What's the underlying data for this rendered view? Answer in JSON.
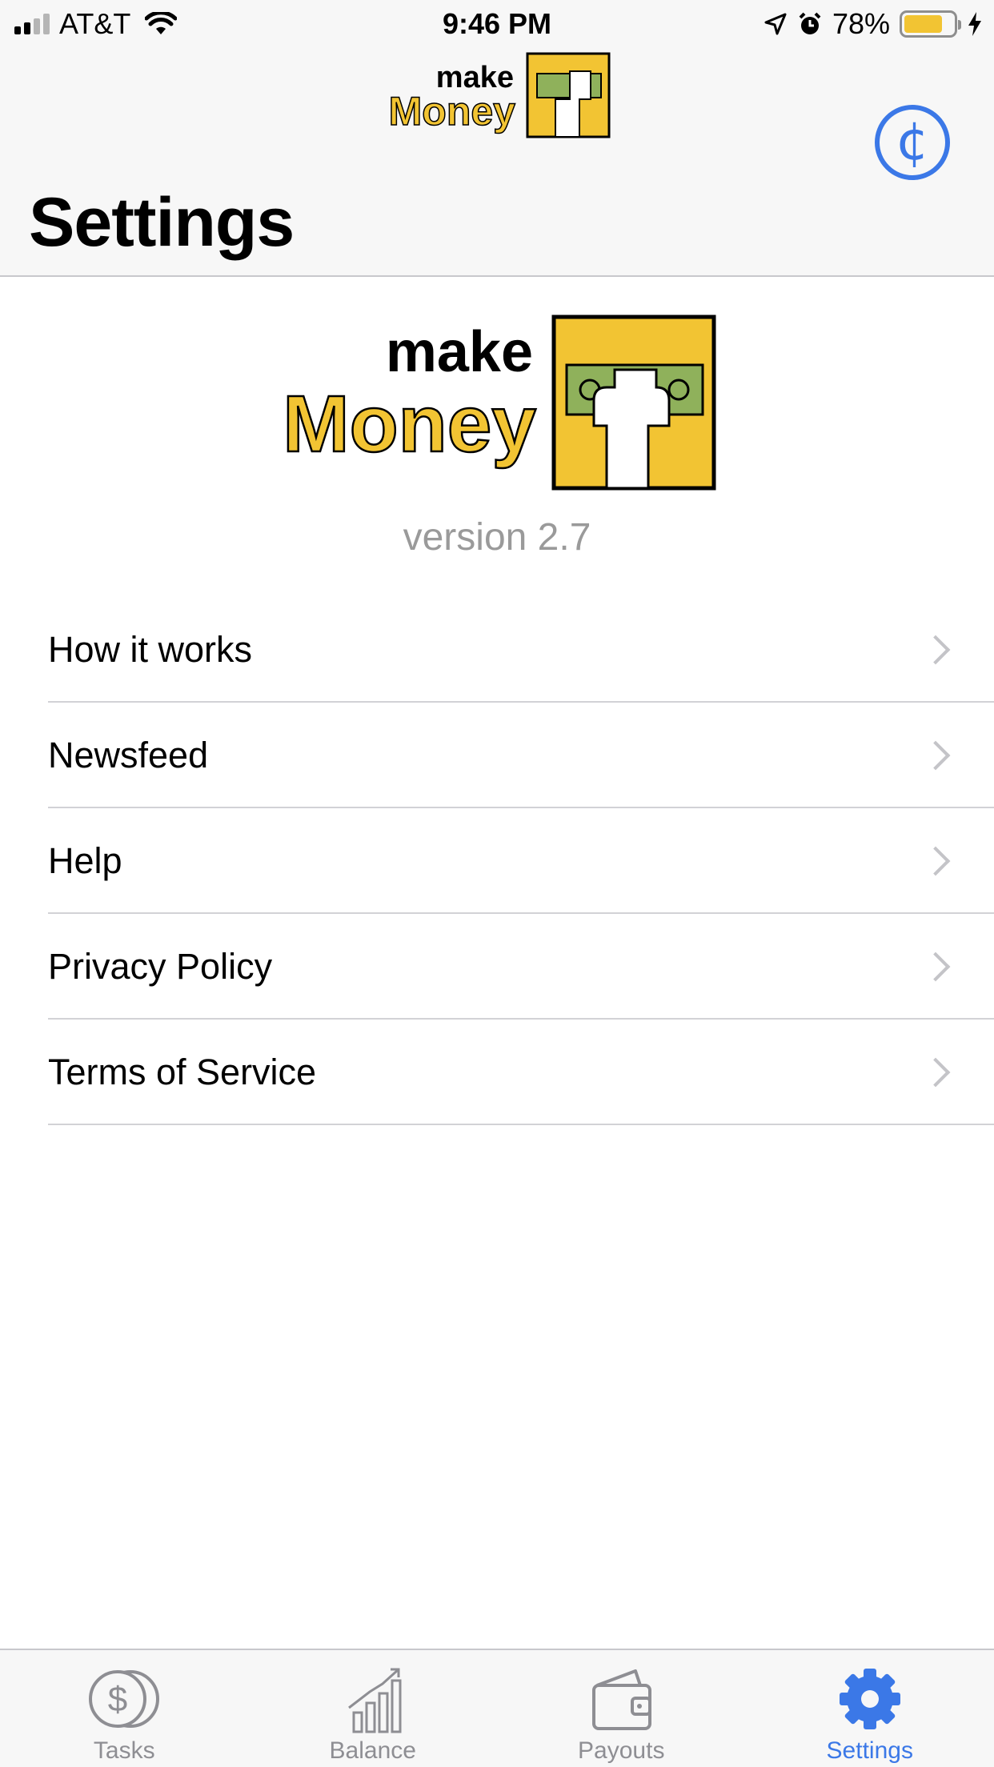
{
  "status_bar": {
    "carrier": "AT&T",
    "time": "9:46 PM",
    "battery_percent": "78%",
    "battery_level": 0.78
  },
  "nav_bar": {
    "logo_make": "make",
    "logo_money": "Money",
    "coin_icon": "¢",
    "title": "Settings"
  },
  "main": {
    "logo_make": "make",
    "logo_money": "Money",
    "version": "version 2.7",
    "menu": [
      {
        "label": "How it works"
      },
      {
        "label": "Newsfeed"
      },
      {
        "label": "Help"
      },
      {
        "label": "Privacy Policy"
      },
      {
        "label": "Terms of Service"
      }
    ]
  },
  "tab_bar": {
    "tabs": [
      {
        "label": "Tasks",
        "icon": "coins-icon"
      },
      {
        "label": "Balance",
        "icon": "chart-icon"
      },
      {
        "label": "Payouts",
        "icon": "wallet-icon"
      },
      {
        "label": "Settings",
        "icon": "gear-icon",
        "active": true
      }
    ]
  },
  "colors": {
    "accent": "#3b78e7",
    "brand_yellow": "#f2c433",
    "inactive": "#8e8e93"
  }
}
